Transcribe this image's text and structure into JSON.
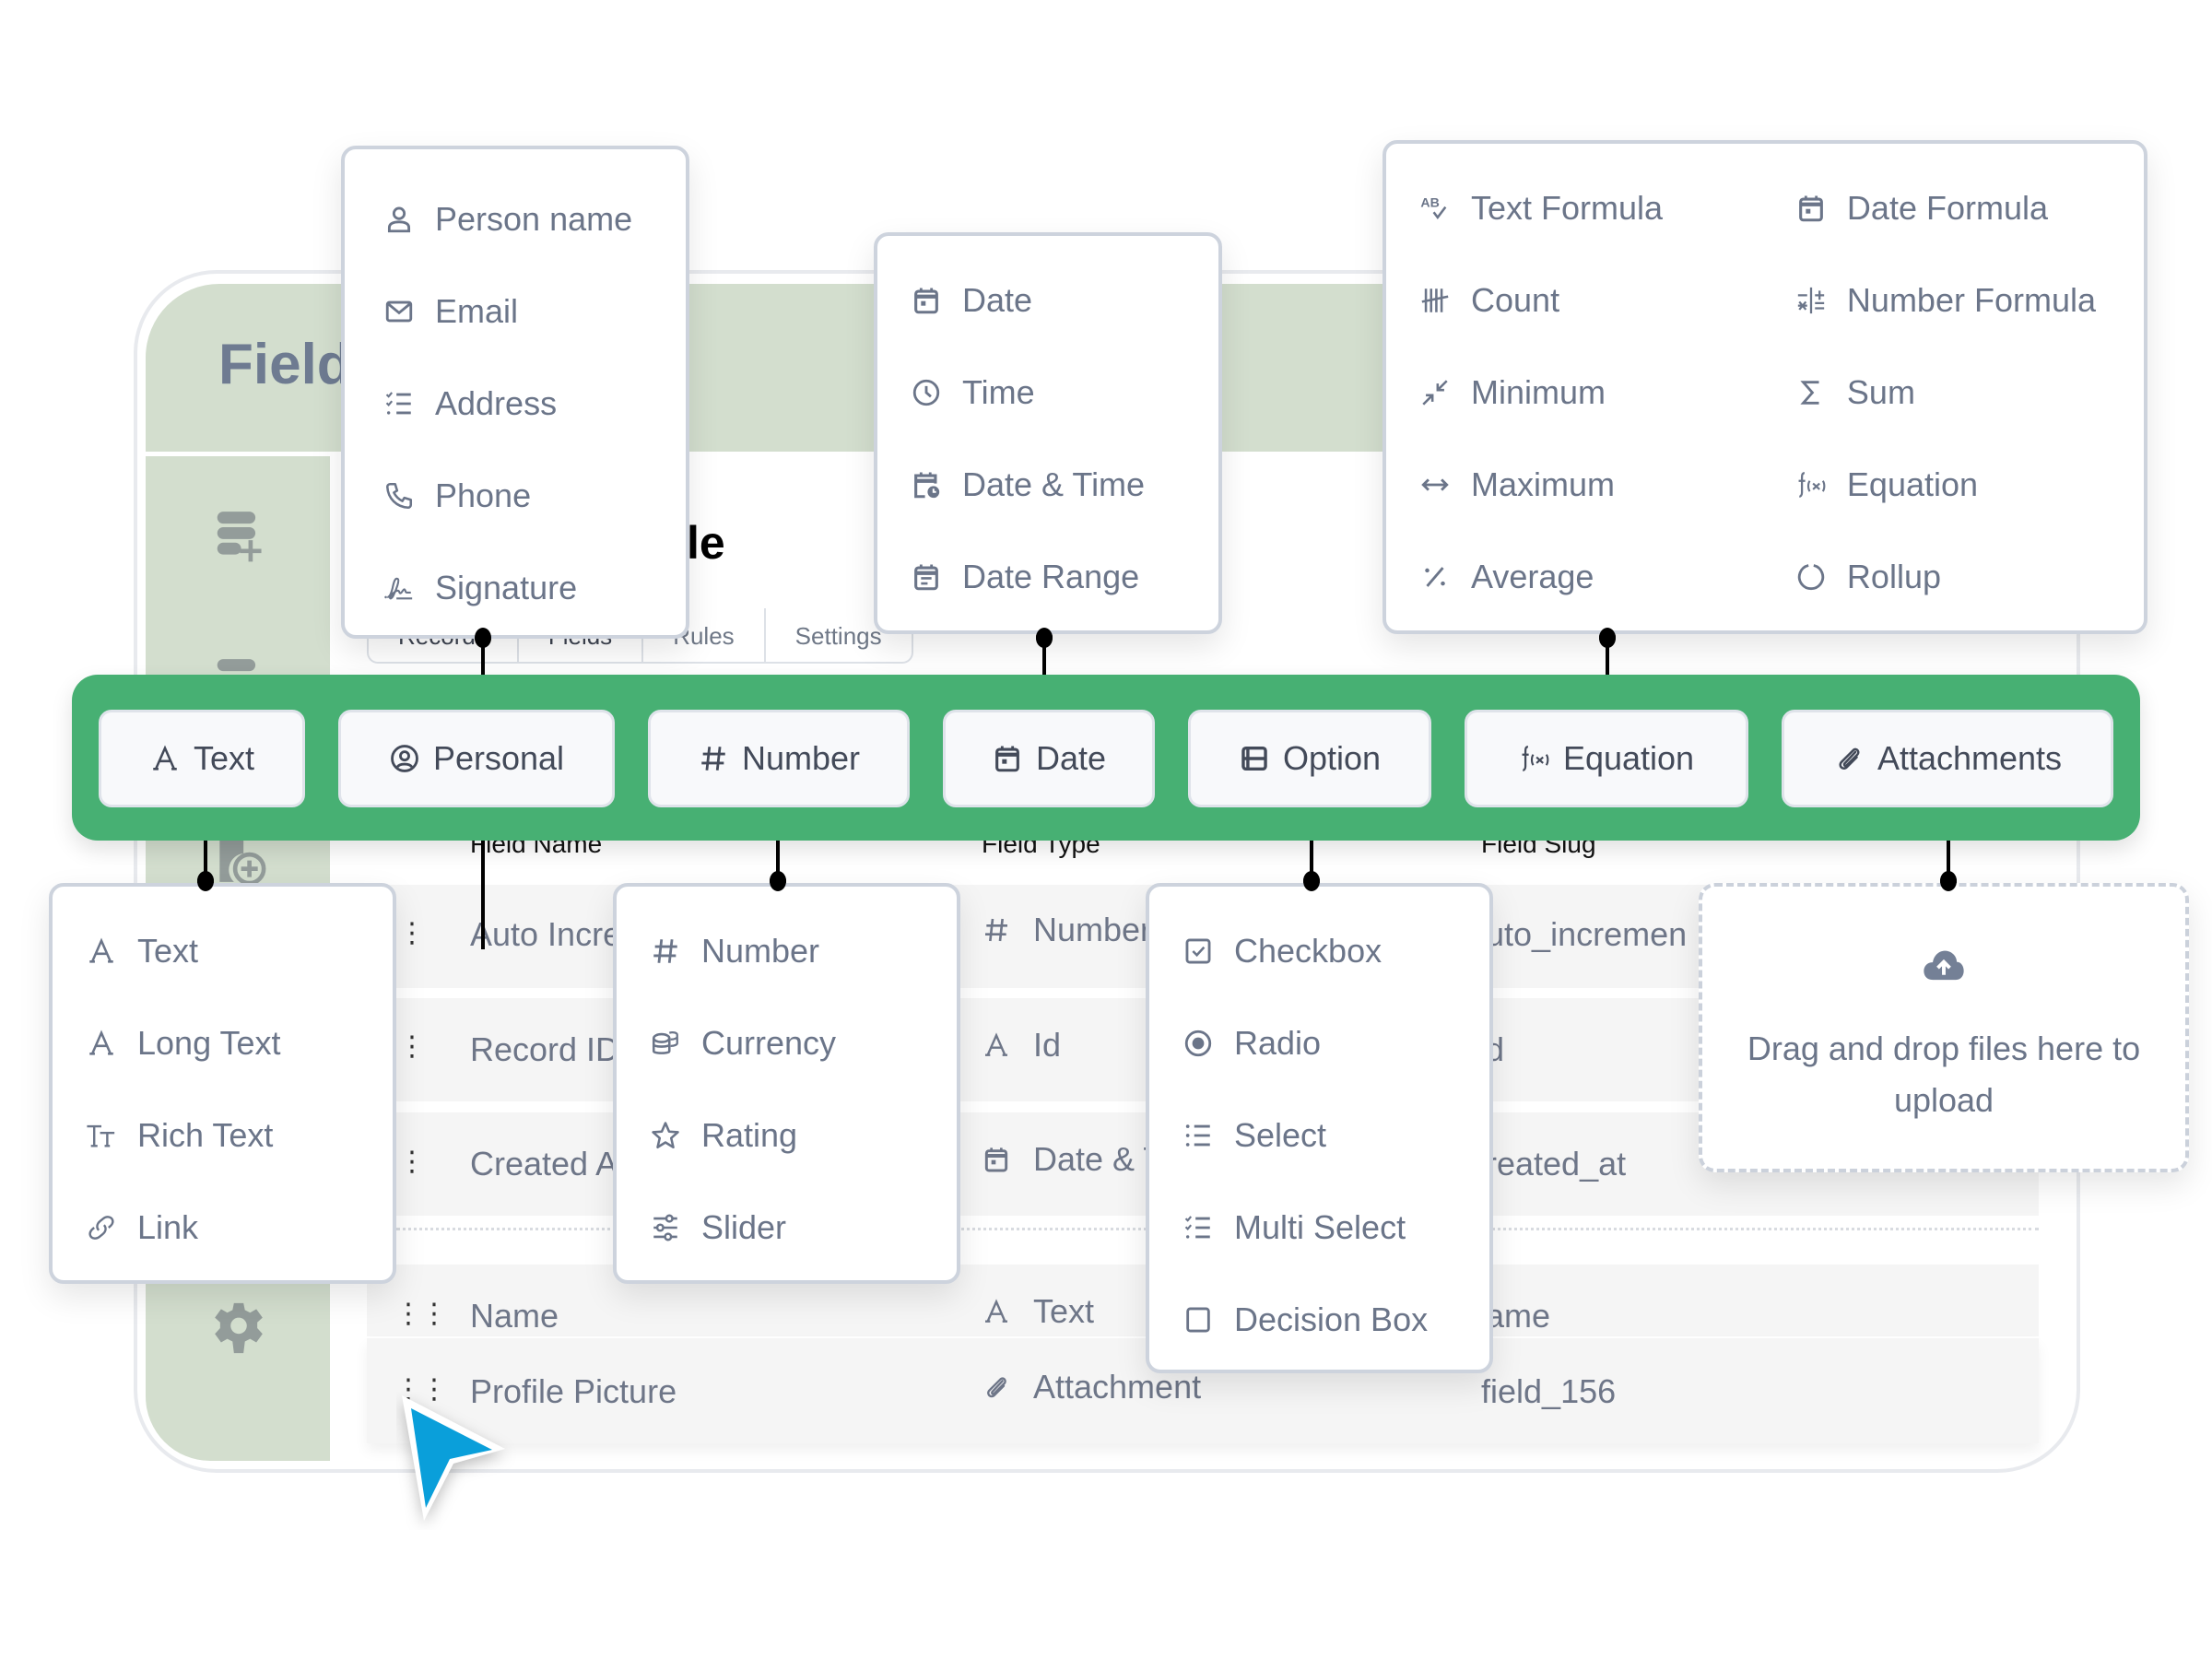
{
  "app": {
    "title_fragment": "Field",
    "page_title_fragment": "le",
    "tabs": [
      "Records",
      "Fields",
      "Rules",
      "Settings"
    ]
  },
  "table": {
    "headers": [
      "Field Name",
      "Field Type",
      "Field Slug"
    ],
    "rows": [
      {
        "name": "Auto Incre",
        "type": "Number",
        "type_icon": "hash-icon",
        "slug": "uto_incremen"
      },
      {
        "name": "Record ID",
        "type": "Id",
        "type_icon": "text-a-icon",
        "slug": "d"
      },
      {
        "name": "Created A",
        "type": "Date & T",
        "type_icon": "calendar-icon",
        "slug": "reated_at"
      },
      {
        "name": "Name",
        "type": "Text",
        "type_icon": "text-a-icon",
        "slug": "ame"
      },
      {
        "name": "Profile Picture",
        "type": "Attachment",
        "type_icon": "paperclip-icon",
        "slug": "field_156"
      }
    ]
  },
  "toolbar": {
    "color": "#47b073",
    "buttons": [
      {
        "label": "Text",
        "icon": "text-a-icon"
      },
      {
        "label": "Personal",
        "icon": "user-circle-icon"
      },
      {
        "label": "Number",
        "icon": "hash-icon"
      },
      {
        "label": "Date",
        "icon": "calendar-icon"
      },
      {
        "label": "Option",
        "icon": "option-box-icon"
      },
      {
        "label": "Equation",
        "icon": "function-icon"
      },
      {
        "label": "Attachments",
        "icon": "paperclip-icon"
      }
    ]
  },
  "menus": {
    "personal": [
      {
        "label": "Person name",
        "icon": "user-icon"
      },
      {
        "label": "Email",
        "icon": "mail-icon"
      },
      {
        "label": "Address",
        "icon": "list-check-icon"
      },
      {
        "label": "Phone",
        "icon": "phone-icon"
      },
      {
        "label": "Signature",
        "icon": "signature-icon"
      }
    ],
    "date": [
      {
        "label": "Date",
        "icon": "calendar-icon"
      },
      {
        "label": "Time",
        "icon": "clock-icon"
      },
      {
        "label": "Date & Time",
        "icon": "calendar-clock-icon"
      },
      {
        "label": "Date Range",
        "icon": "calendar-range-icon"
      }
    ],
    "equation_left": [
      {
        "label": "Text Formula",
        "icon": "spellcheck-icon"
      },
      {
        "label": "Count",
        "icon": "tally-icon"
      },
      {
        "label": "Minimum",
        "icon": "minimize-icon"
      },
      {
        "label": "Maximum",
        "icon": "arrows-horizontal-icon"
      },
      {
        "label": "Average",
        "icon": "percent-icon"
      }
    ],
    "equation_right": [
      {
        "label": "Date Formula",
        "icon": "calendar-icon"
      },
      {
        "label": "Number Formula",
        "icon": "calculator-icon"
      },
      {
        "label": "Sum",
        "icon": "sigma-icon"
      },
      {
        "label": "Equation",
        "icon": "function-icon"
      },
      {
        "label": "Rollup",
        "icon": "circle-icon"
      }
    ],
    "text": [
      {
        "label": "Text",
        "icon": "text-a-icon"
      },
      {
        "label": "Long Text",
        "icon": "text-a-icon"
      },
      {
        "label": "Rich Text",
        "icon": "text-size-icon"
      },
      {
        "label": "Link",
        "icon": "link-icon"
      }
    ],
    "number": [
      {
        "label": "Number",
        "icon": "hash-icon"
      },
      {
        "label": "Currency",
        "icon": "coins-icon"
      },
      {
        "label": "Rating",
        "icon": "star-icon"
      },
      {
        "label": "Slider",
        "icon": "sliders-icon"
      }
    ],
    "option": [
      {
        "label": "Checkbox",
        "icon": "checkbox-icon"
      },
      {
        "label": "Radio",
        "icon": "radio-icon"
      },
      {
        "label": "Select",
        "icon": "list-icon"
      },
      {
        "label": "Multi Select",
        "icon": "list-check-icon"
      },
      {
        "label": "Decision Box",
        "icon": "square-icon"
      }
    ]
  },
  "upload": {
    "text": "Drag and drop files here to upload",
    "icon": "cloud-upload-icon"
  }
}
